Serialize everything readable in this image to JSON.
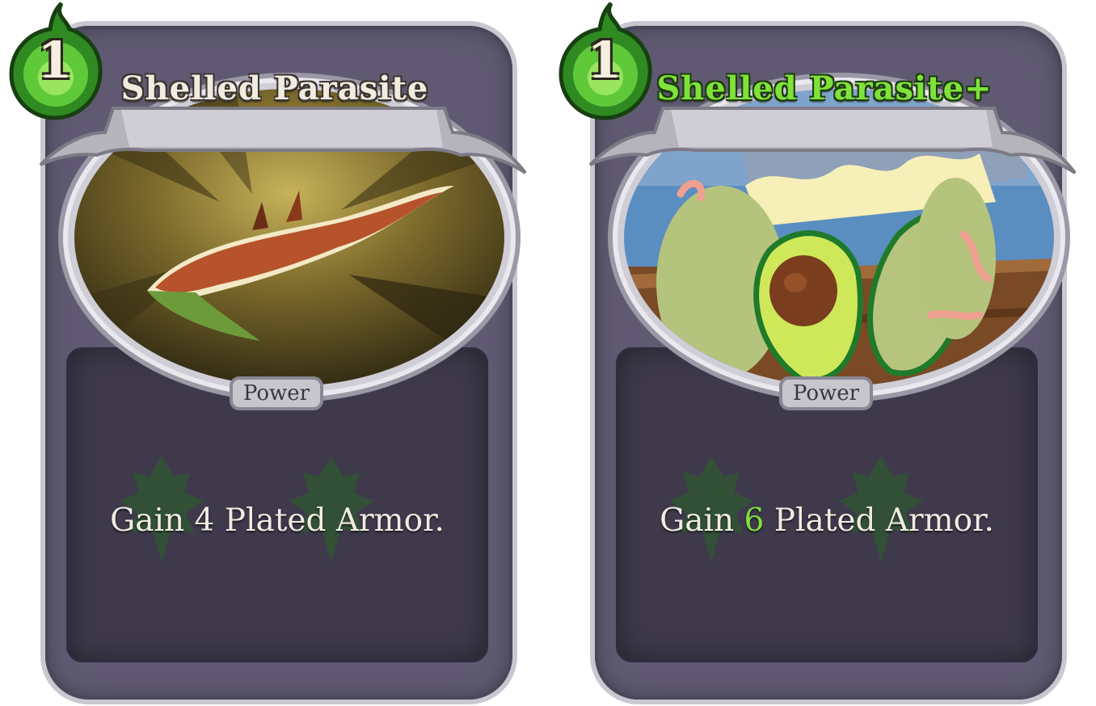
{
  "cards": [
    {
      "cost": "1",
      "title": "Shelled Parasite",
      "type": "Power",
      "desc_prefix": "Gain ",
      "desc_value": "4",
      "desc_suffix": " Plated Armor.",
      "upgraded": false,
      "art": "parasite-art"
    },
    {
      "cost": "1",
      "title": "Shelled Parasite+",
      "type": "Power",
      "desc_prefix": "Gain ",
      "desc_value": "6",
      "desc_suffix": " Plated Armor.",
      "upgraded": true,
      "art": "avocado-art"
    }
  ],
  "colors": {
    "frame": "#5f5a71",
    "energy_green": "#3ea82a",
    "upgrade_green": "#7fe23a",
    "text_light": "#f1ece2"
  },
  "icons": {
    "energy": "green-energy-orb-icon",
    "leaf": "leaf-watermark-icon"
  }
}
